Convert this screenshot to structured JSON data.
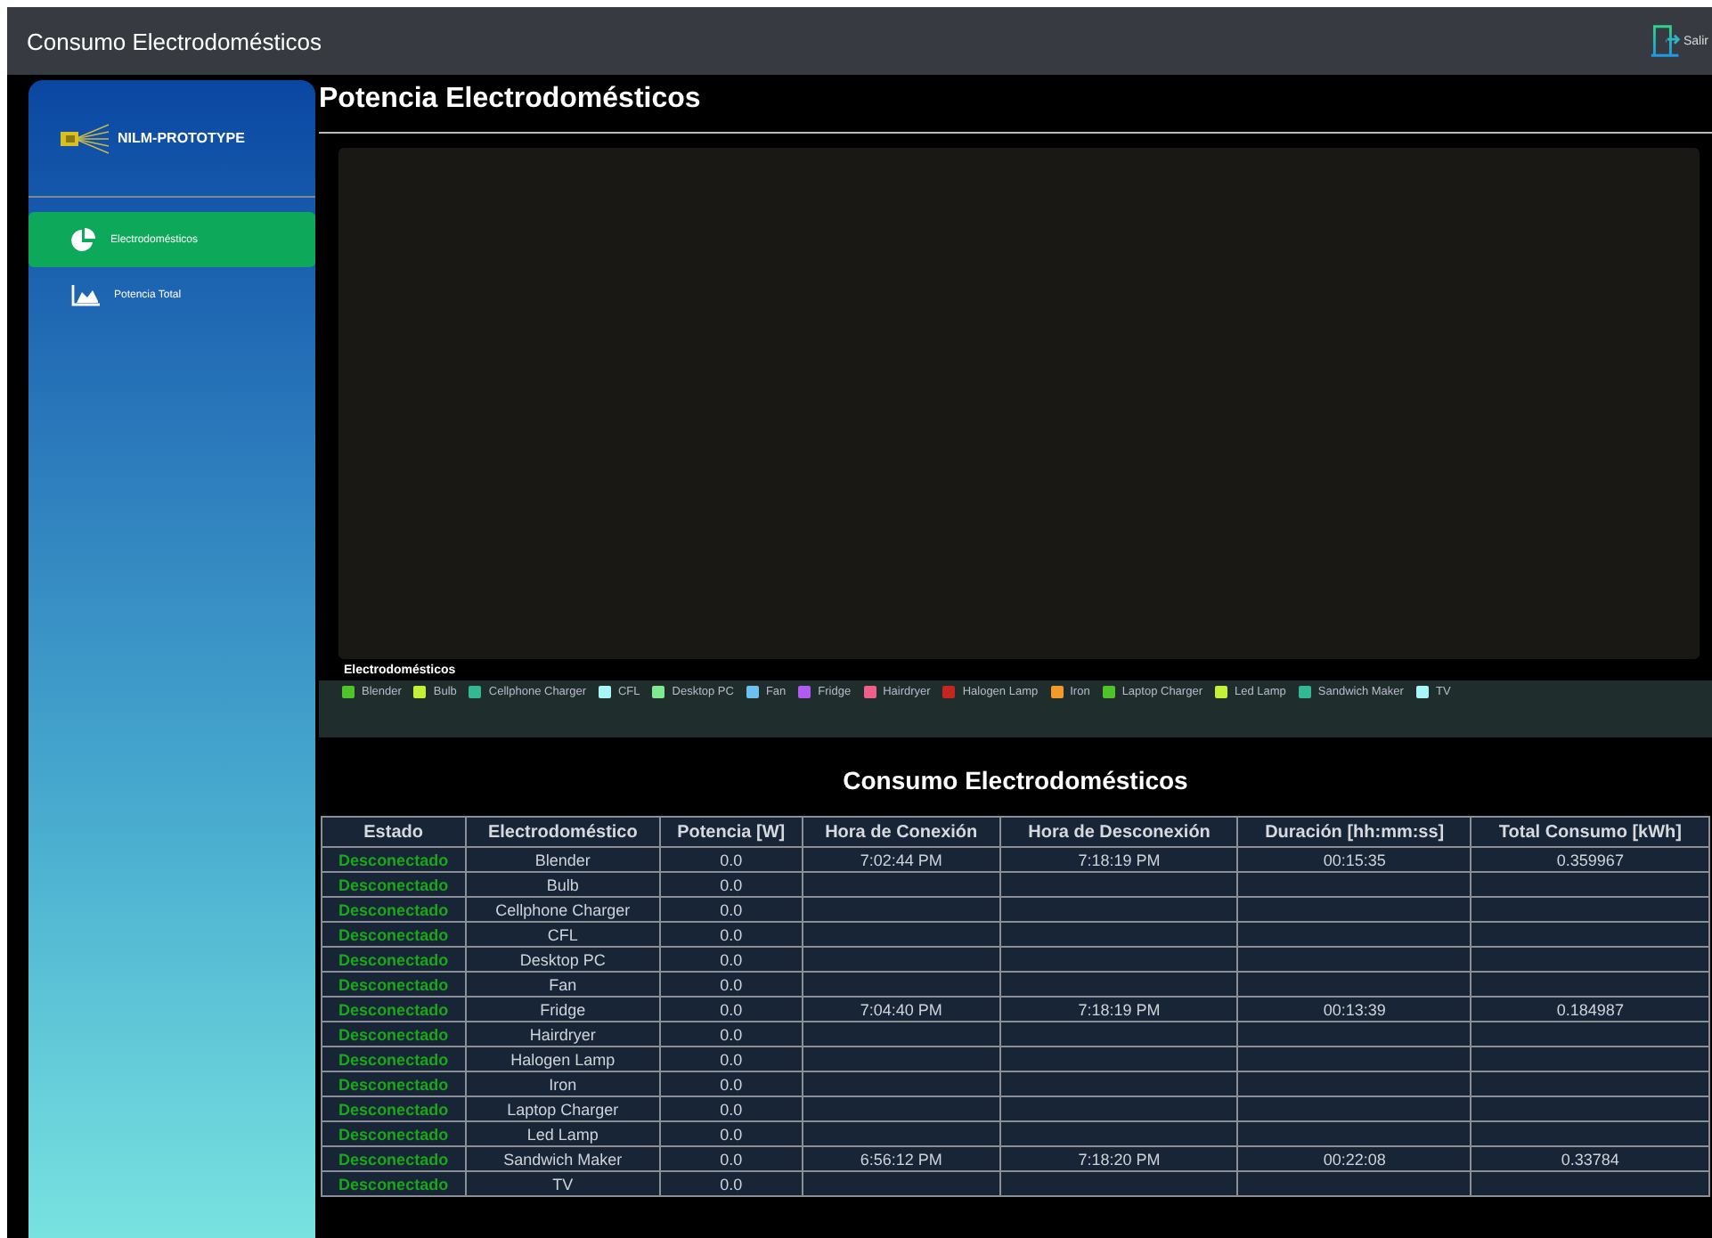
{
  "window": {
    "title": "Consumo Electrodomésticos"
  },
  "exit_button": {
    "label": "Salir"
  },
  "sidebar": {
    "logo_text": "NILM-PROTOTYPE",
    "items": [
      {
        "label": "Electrodomésticos",
        "kind": "pie",
        "selected": true
      },
      {
        "label": "Potencia Total",
        "kind": "area",
        "selected": false
      }
    ]
  },
  "page_title": "Potencia Electrodomésticos",
  "chart": {
    "legend_title": "Electrodomésticos",
    "legend": [
      {
        "label": "Blender",
        "color": "#4ec32a"
      },
      {
        "label": "Bulb",
        "color": "#c4f03a"
      },
      {
        "label": "Cellphone Charger",
        "color": "#33b894"
      },
      {
        "label": "CFL",
        "color": "#a8f6f8"
      },
      {
        "label": "Desktop PC",
        "color": "#7fe890"
      },
      {
        "label": "Fan",
        "color": "#6cc1f0"
      },
      {
        "label": "Fridge",
        "color": "#b05cf0"
      },
      {
        "label": "Hairdryer",
        "color": "#ee5f8a"
      },
      {
        "label": "Halogen Lamp",
        "color": "#c4271f"
      },
      {
        "label": "Iron",
        "color": "#f39a2c"
      },
      {
        "label": "Laptop Charger",
        "color": "#4ec32a"
      },
      {
        "label": "Led Lamp",
        "color": "#c4f03a"
      },
      {
        "label": "Sandwich Maker",
        "color": "#33b894"
      },
      {
        "label": "TV",
        "color": "#a8f6f8"
      }
    ]
  },
  "table": {
    "title": "Consumo Electrodomésticos",
    "columns": [
      "Estado",
      "Electrodoméstico",
      "Potencia [W]",
      "Hora de Conexión",
      "Hora de Desconexión",
      "Duración [hh:mm:ss]",
      "Total Consumo [kWh]"
    ],
    "rows": [
      [
        "Desconectado",
        "Blender",
        "0.0",
        "7:02:44 PM",
        "7:18:19 PM",
        "00:15:35",
        "0.359967"
      ],
      [
        "Desconectado",
        "Bulb",
        "0.0",
        "",
        "",
        "",
        ""
      ],
      [
        "Desconectado",
        "Cellphone Charger",
        "0.0",
        "",
        "",
        "",
        ""
      ],
      [
        "Desconectado",
        "CFL",
        "0.0",
        "",
        "",
        "",
        ""
      ],
      [
        "Desconectado",
        "Desktop PC",
        "0.0",
        "",
        "",
        "",
        ""
      ],
      [
        "Desconectado",
        "Fan",
        "0.0",
        "",
        "",
        "",
        ""
      ],
      [
        "Desconectado",
        "Fridge",
        "0.0",
        "7:04:40 PM",
        "7:18:19 PM",
        "00:13:39",
        "0.184987"
      ],
      [
        "Desconectado",
        "Hairdryer",
        "0.0",
        "",
        "",
        "",
        ""
      ],
      [
        "Desconectado",
        "Halogen Lamp",
        "0.0",
        "",
        "",
        "",
        ""
      ],
      [
        "Desconectado",
        "Iron",
        "0.0",
        "",
        "",
        "",
        ""
      ],
      [
        "Desconectado",
        "Laptop Charger",
        "0.0",
        "",
        "",
        "",
        ""
      ],
      [
        "Desconectado",
        "Led Lamp",
        "0.0",
        "",
        "",
        "",
        ""
      ],
      [
        "Desconectado",
        "Sandwich Maker",
        "0.0",
        "6:56:12 PM",
        "7:18:20 PM",
        "00:22:08",
        "0.33784"
      ],
      [
        "Desconectado",
        "TV",
        "0.0",
        "",
        "",
        "",
        ""
      ]
    ]
  }
}
